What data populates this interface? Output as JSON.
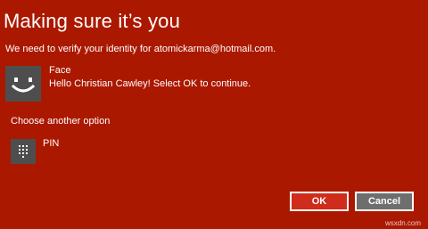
{
  "dialog": {
    "title": "Making sure it’s you",
    "subtitle": "We need to verify your identity for atomickarma@hotmail.com."
  },
  "face_option": {
    "icon": "smiley-face-icon",
    "label": "Face",
    "description": "Hello Christian Cawley! Select OK to continue."
  },
  "another_option": {
    "label": "Choose another option"
  },
  "pin_option": {
    "icon": "keypad-icon",
    "label": "PIN"
  },
  "buttons": {
    "ok_label": "OK",
    "cancel_label": "Cancel"
  },
  "watermark": "wsxdn.com",
  "colors": {
    "background": "#ab1800",
    "tile": "#4e4e4e",
    "ok_button": "#cf2c1c",
    "cancel_button": "#6e6e6e",
    "text": "#ffffff"
  }
}
